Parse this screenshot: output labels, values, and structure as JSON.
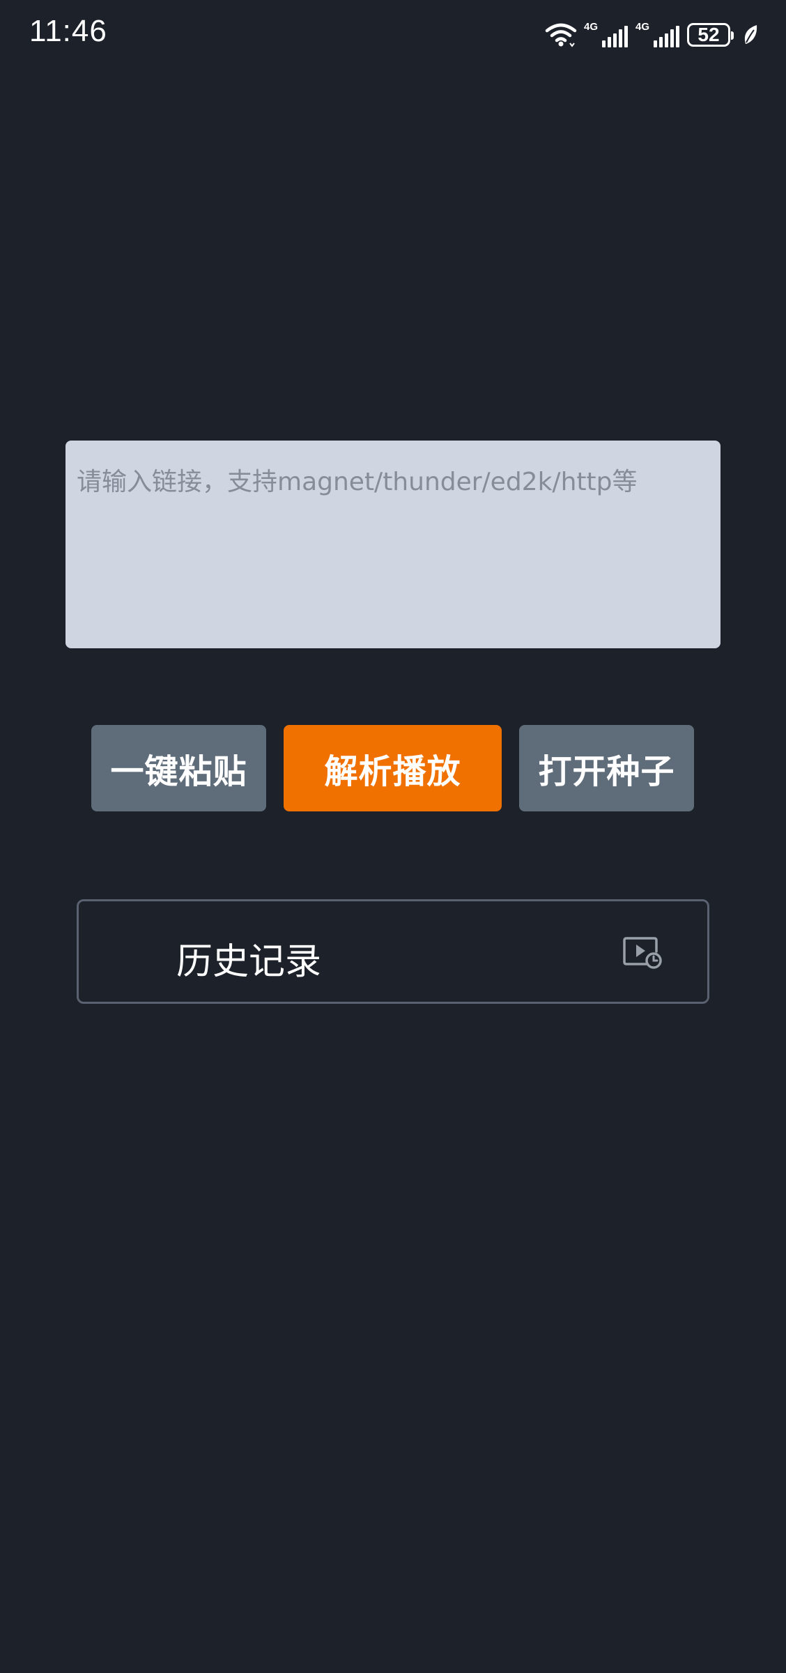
{
  "status_bar": {
    "time": "11:46",
    "battery_level": "52",
    "network_1": "4G",
    "network_2": "4G",
    "icons": [
      "wifi-icon",
      "signal-icon",
      "signal-icon",
      "battery-icon",
      "leaf-icon"
    ]
  },
  "link_input": {
    "value": "",
    "placeholder": "请输入链接，支持magnet/thunder/ed2k/http等"
  },
  "actions": {
    "paste_label": "一键粘贴",
    "play_label": "解析播放",
    "torrent_label": "打开种子"
  },
  "history": {
    "label": "历史记录",
    "icon": "play-history-icon"
  },
  "colors": {
    "background": "#1c212a",
    "input_background": "#cfd6e2",
    "primary": "#f17100",
    "secondary": "#5f6c7a",
    "border": "#5a6170"
  }
}
